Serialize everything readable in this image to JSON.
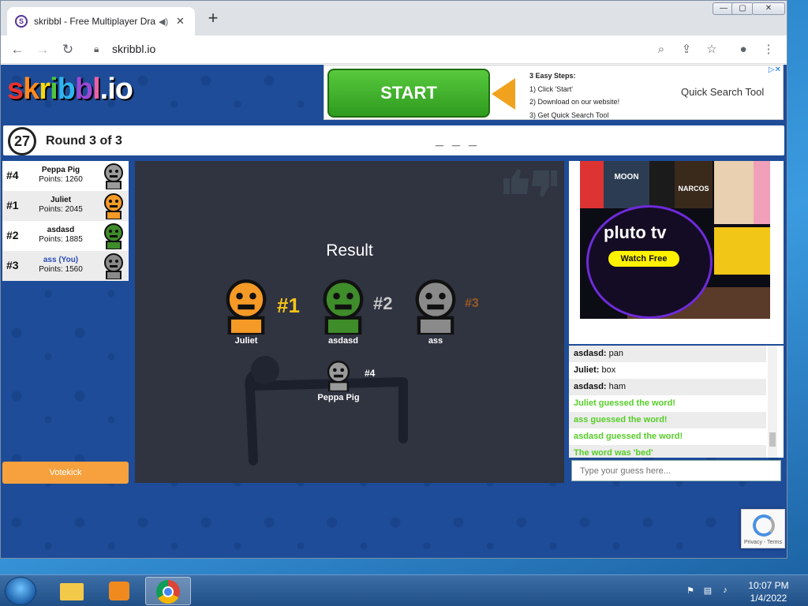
{
  "browser": {
    "tab_title": "skribbl - Free Multiplayer Dra",
    "url": "skribbl.io",
    "new_tab_symbol": "+"
  },
  "ad_top": {
    "button": "START",
    "steps_title": "3 Easy Steps:",
    "step1": "1) Click 'Start'",
    "step2": "2) Download on our website!",
    "step3": "3) Get Quick Search Tool",
    "product": "Quick Search Tool"
  },
  "game": {
    "logo": "skribbl.io",
    "timer": "27",
    "round": "Round 3 of 3",
    "word": "_ _ _",
    "votekick": "Votekick",
    "result_title": "Result"
  },
  "players": [
    {
      "rank": "#4",
      "name": "Peppa Pig",
      "points": "Points: 1260",
      "color": "#9a9a9a",
      "me": false
    },
    {
      "rank": "#1",
      "name": "Juliet",
      "points": "Points: 2045",
      "color": "#f59a26",
      "me": false
    },
    {
      "rank": "#2",
      "name": "asdasd",
      "points": "Points: 1885",
      "color": "#3e8c2a",
      "me": false
    },
    {
      "rank": "#3",
      "name": "ass (You)",
      "points": "Points: 1560",
      "color": "#8a8a8a",
      "me": true
    }
  ],
  "podium": [
    {
      "rank": "#1",
      "name": "Juliet",
      "rank_color": "#f5c518"
    },
    {
      "rank": "#2",
      "name": "asdasd",
      "rank_color": "#c8c8c8"
    },
    {
      "rank": "#3",
      "name": "ass",
      "rank_color": "#9b5a22"
    },
    {
      "rank": "#4",
      "name": "Peppa Pig",
      "rank_color": "#ffffff"
    }
  ],
  "ad_right": {
    "brand": "pluto tv",
    "cta": "Watch Free",
    "poster_moon": "MOON",
    "poster_narcos": "NARCOS"
  },
  "chat": [
    {
      "name": "asdasd:",
      "text": " pan",
      "system": false
    },
    {
      "name": "Juliet:",
      "text": " box",
      "system": false
    },
    {
      "name": "asdasd:",
      "text": " ham",
      "system": false
    },
    {
      "name": "",
      "text": "Juliet guessed the word!",
      "system": true
    },
    {
      "name": "",
      "text": "ass guessed the word!",
      "system": true
    },
    {
      "name": "",
      "text": "asdasd guessed the word!",
      "system": true
    },
    {
      "name": "",
      "text": "The word was 'bed'",
      "system": true
    }
  ],
  "guess_placeholder": "Type your guess here...",
  "recaptcha_text": "Privacy - Terms",
  "taskbar": {
    "time": "10:07 PM",
    "date": "1/4/2022"
  }
}
